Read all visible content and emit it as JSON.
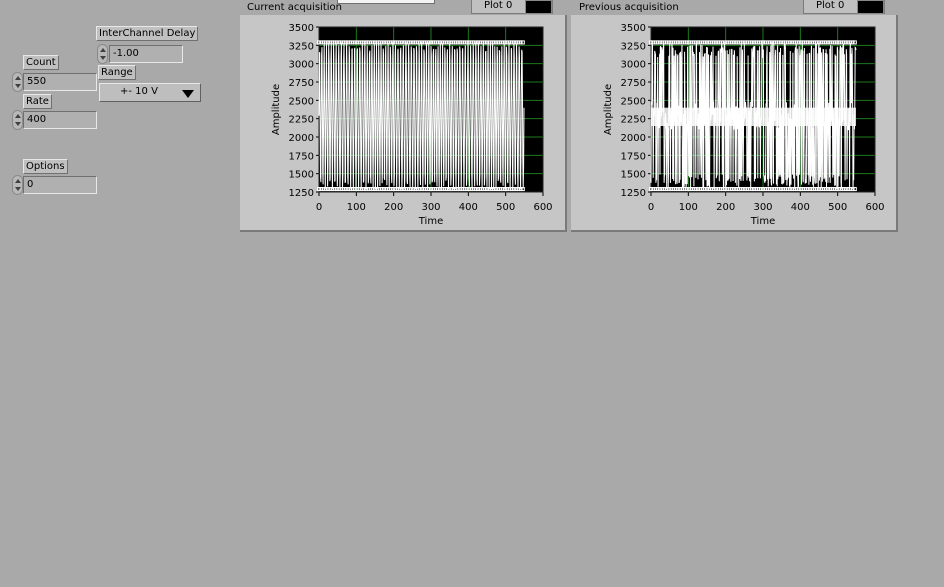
{
  "controls": {
    "count": {
      "label": "Count",
      "value": "550"
    },
    "rate": {
      "label": "Rate",
      "value": "400"
    },
    "options": {
      "label": "Options",
      "value": "0"
    },
    "interchannel_delay": {
      "label": "InterChannel Delay",
      "value": "-1.00"
    },
    "range": {
      "label": "Range",
      "value": "+- 10 V"
    }
  },
  "graphs": [
    {
      "title": "Current acquisition",
      "legend": "Plot 0",
      "xlabel": "Time",
      "ylabel": "Amplitude",
      "pattern": "sine"
    },
    {
      "title": "Previous acquisition",
      "legend": "Plot 0",
      "xlabel": "Time",
      "ylabel": "Amplitude",
      "pattern": "dense"
    }
  ],
  "chart_data": [
    {
      "type": "line",
      "title": "Current acquisition",
      "xlabel": "Time",
      "ylabel": "Amplitude",
      "xlim": [
        0,
        600
      ],
      "ylim": [
        1250,
        3500
      ],
      "x_ticks": [
        "0",
        "100",
        "200",
        "300",
        "400",
        "500",
        "600"
      ],
      "y_ticks": [
        "3500",
        "3250",
        "3000",
        "2750",
        "2500",
        "2250",
        "2000",
        "1750",
        "1500",
        "1250"
      ],
      "grid": true,
      "series": [
        {
          "name": "Plot 0",
          "x_range": [
            0,
            549
          ],
          "min": 1290,
          "max": 3290,
          "shape": "oscillating"
        }
      ]
    },
    {
      "type": "line",
      "title": "Previous acquisition",
      "xlabel": "Time",
      "ylabel": "Amplitude",
      "xlim": [
        0,
        600
      ],
      "ylim": [
        1250,
        3500
      ],
      "x_ticks": [
        "0",
        "100",
        "200",
        "300",
        "400",
        "500",
        "600"
      ],
      "y_ticks": [
        "3500",
        "3250",
        "3000",
        "2750",
        "2500",
        "2250",
        "2000",
        "1750",
        "1500",
        "1250"
      ],
      "grid": true,
      "series": [
        {
          "name": "Plot 0",
          "x_range": [
            0,
            549
          ],
          "min": 1290,
          "max": 3290,
          "shape": "oscillating"
        }
      ]
    }
  ]
}
